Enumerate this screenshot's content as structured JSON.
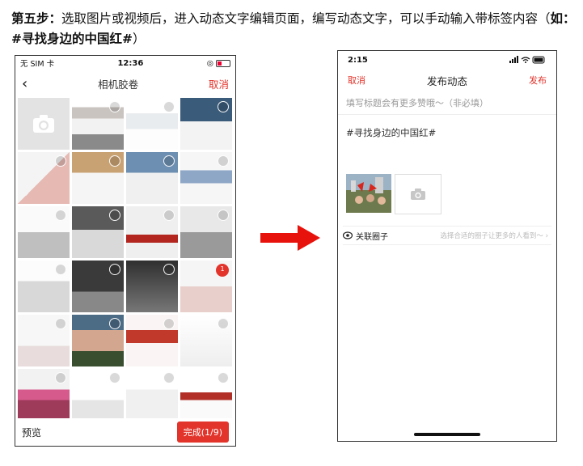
{
  "instruction": {
    "step_label": "第五步：",
    "body": "选取图片或视频后，进入动态文字编辑页面，编写动态文字，可以手动输入带标签内容（",
    "example_label": "如：#寻找身边的中国红#",
    "close_paren": "）"
  },
  "left_phone": {
    "status": {
      "carrier": "无 SIM 卡",
      "time": "12:36"
    },
    "nav": {
      "back": "‹",
      "title": "相机胶卷",
      "cancel": "取消"
    },
    "selected_badge": "1",
    "bottom": {
      "preview": "预览",
      "done": "完成(1/9)"
    },
    "colors": {
      "accent": "#e2342b"
    }
  },
  "right_phone": {
    "status": {
      "time": "2:15"
    },
    "nav": {
      "cancel": "取消",
      "title": "发布动态",
      "publish": "发布"
    },
    "title_placeholder": "填写标题会有更多赞哦～（非必填）",
    "content": "#寻找身边的中国红#",
    "circle": {
      "label": "关联圈子",
      "placeholder": "选择合适的圈子让更多的人看到～ ›"
    }
  }
}
